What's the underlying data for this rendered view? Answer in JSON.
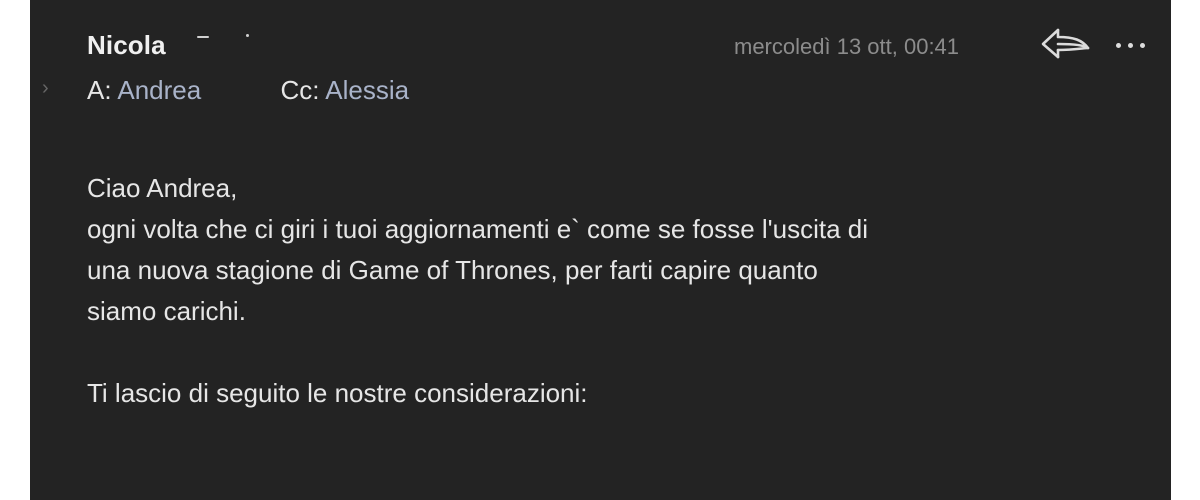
{
  "header": {
    "sender": "Nicola",
    "timestamp": "mercoledì 13 ott, 00:41",
    "to_label": "A:",
    "to_value": "Andrea",
    "cc_label": "Cc:",
    "cc_value": "Alessia",
    "expand_chevron": "›"
  },
  "icons": {
    "reply": "reply-icon",
    "more": "more-icon",
    "expand": "chevron-right-icon"
  },
  "body": {
    "greeting": "Ciao Andrea,",
    "line1": "ogni volta che ci giri i tuoi aggiornamenti e` come se fosse l'uscita di",
    "line2": "una nuova stagione di Game of Thrones, per farti capire quanto",
    "line3": "siamo carichi.",
    "line4": "Ti lascio di seguito le nostre considerazioni:"
  },
  "colors": {
    "panel_background": "#232323",
    "page_background": "#ffffff",
    "text": "#e6e6e6",
    "recipient": "#a9b3c9",
    "timestamp": "#8c8c8c"
  }
}
